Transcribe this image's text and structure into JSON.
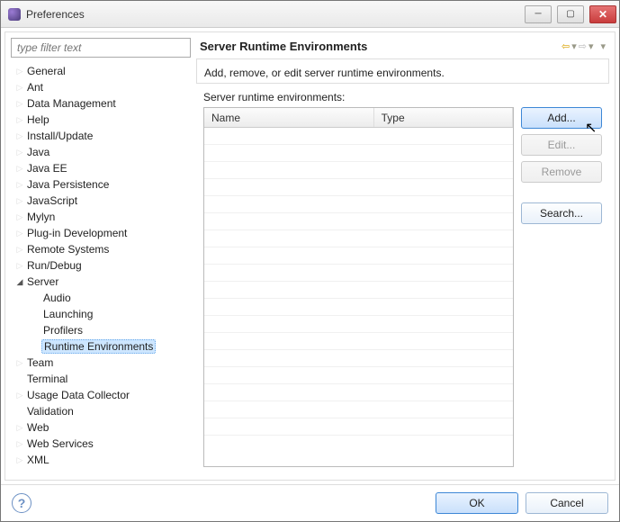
{
  "window": {
    "title": "Preferences"
  },
  "sidebar": {
    "filter_placeholder": "type filter text",
    "items": [
      {
        "label": "General",
        "expandable": true,
        "expanded": false
      },
      {
        "label": "Ant",
        "expandable": true,
        "expanded": false
      },
      {
        "label": "Data Management",
        "expandable": true,
        "expanded": false
      },
      {
        "label": "Help",
        "expandable": true,
        "expanded": false
      },
      {
        "label": "Install/Update",
        "expandable": true,
        "expanded": false
      },
      {
        "label": "Java",
        "expandable": true,
        "expanded": false
      },
      {
        "label": "Java EE",
        "expandable": true,
        "expanded": false
      },
      {
        "label": "Java Persistence",
        "expandable": true,
        "expanded": false
      },
      {
        "label": "JavaScript",
        "expandable": true,
        "expanded": false
      },
      {
        "label": "Mylyn",
        "expandable": true,
        "expanded": false
      },
      {
        "label": "Plug-in Development",
        "expandable": true,
        "expanded": false
      },
      {
        "label": "Remote Systems",
        "expandable": true,
        "expanded": false
      },
      {
        "label": "Run/Debug",
        "expandable": true,
        "expanded": false
      },
      {
        "label": "Server",
        "expandable": true,
        "expanded": true,
        "children": [
          {
            "label": "Audio"
          },
          {
            "label": "Launching"
          },
          {
            "label": "Profilers"
          },
          {
            "label": "Runtime Environments",
            "selected": true
          }
        ]
      },
      {
        "label": "Team",
        "expandable": true,
        "expanded": false
      },
      {
        "label": "Terminal",
        "expandable": false
      },
      {
        "label": "Usage Data Collector",
        "expandable": true,
        "expanded": false
      },
      {
        "label": "Validation",
        "expandable": false
      },
      {
        "label": "Web",
        "expandable": true,
        "expanded": false
      },
      {
        "label": "Web Services",
        "expandable": true,
        "expanded": false
      },
      {
        "label": "XML",
        "expandable": true,
        "expanded": false
      }
    ]
  },
  "main": {
    "title": "Server Runtime Environments",
    "description": "Add, remove, or edit server runtime environments.",
    "list_label": "Server runtime environments:",
    "columns": {
      "name": "Name",
      "type": "Type"
    },
    "buttons": {
      "add": "Add...",
      "edit": "Edit...",
      "remove": "Remove",
      "search": "Search..."
    }
  },
  "footer": {
    "ok": "OK",
    "cancel": "Cancel"
  }
}
